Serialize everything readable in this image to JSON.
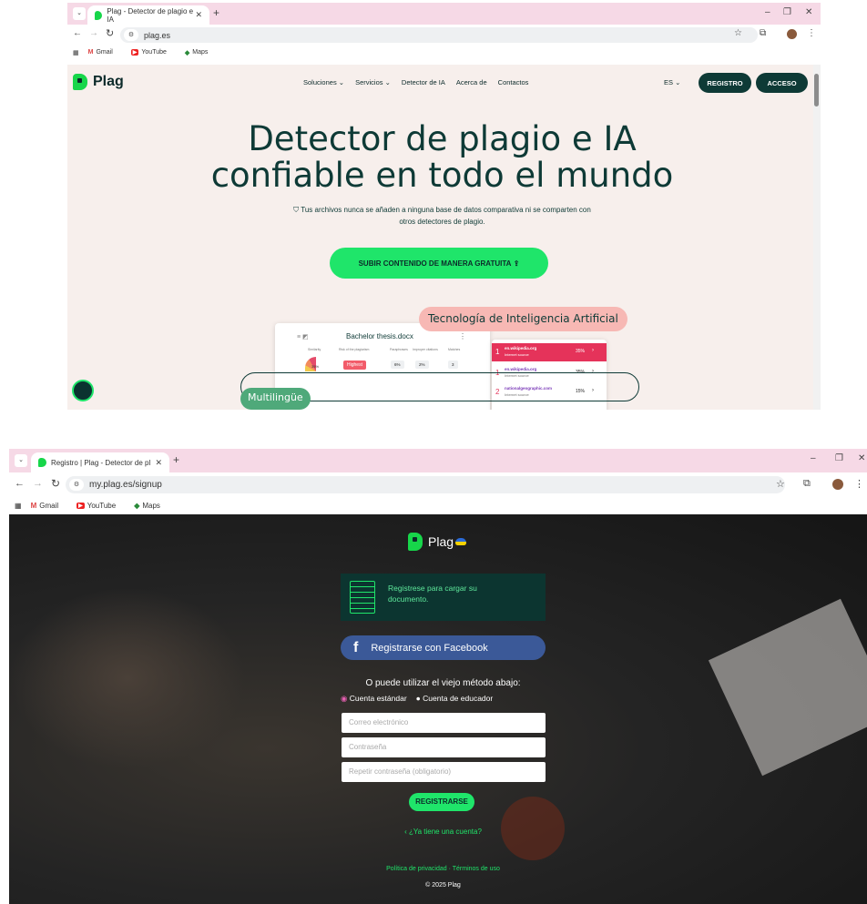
{
  "top_window": {
    "tab_title": "Plag - Detector de plagio e IA",
    "url": "plag.es",
    "bookmarks": [
      "Gmail",
      "YouTube",
      "Maps"
    ],
    "nav": {
      "brand": "Plag",
      "links": [
        "Soluciones",
        "Servicios",
        "Detector de IA",
        "Acerca de",
        "Contactos"
      ],
      "lang": "ES",
      "register": "REGISTRO",
      "login": "ACCESO"
    },
    "hero_line1": "Detector de plagio e IA",
    "hero_line2": "confiable en todo el mundo",
    "subtitle_line1": "Tus archivos nunca se añaden a ninguna base de datos comparativa ni se comparten con",
    "subtitle_line2": "otros detectores de plagio.",
    "cta": "SUBIR CONTENIDO DE MANERA GRATUITA",
    "badge_ai": "Tecnología de Inteligencia Artificial",
    "badge_multi": "Multilingüe",
    "preview": {
      "filename": "Bachelor thesis.docx",
      "metric_labels": [
        "Similarity",
        "Risk of the plagiarism",
        "Paraphrases",
        "Improper citations",
        "Matches"
      ],
      "risk": "Highest",
      "metric_values": [
        "6%",
        "2%",
        "3"
      ],
      "gauge": "35%",
      "sources": [
        {
          "num": "1",
          "site": "en.wikipedia.org",
          "type": "Internet source",
          "pct": "35%"
        },
        {
          "num": "1",
          "site": "en.wikipedia.org",
          "type": "Internet source",
          "pct": "35%"
        },
        {
          "num": "2",
          "site": "nationalgeographic.com",
          "type": "Internet source",
          "pct": "15%"
        }
      ]
    }
  },
  "bottom_window": {
    "tab_title": "Registro | Plag - Detector de pl",
    "url": "my.plag.es/signup",
    "bookmarks": [
      "Gmail",
      "YouTube",
      "Maps"
    ],
    "brand": "Plag",
    "info_text": "Registrese para cargar su documento.",
    "facebook_btn": "Registrarse con Facebook",
    "alt_method": "O puede utilizar el viejo método abajo:",
    "radio_standard": "Cuenta estándar",
    "radio_educator": "Cuenta de educador",
    "email_placeholder": "Correo electrónico",
    "password_placeholder": "Contraseña",
    "repeat_placeholder": "Repetir contraseña (obligatorio)",
    "submit": "REGISTRARSE",
    "have_account": "¿Ya tiene una cuenta?",
    "privacy": "Política de privacidad",
    "terms": "Términos de uso",
    "copyright": "© 2025 Plag"
  },
  "colors": {
    "brand_green": "#1fe56a",
    "brand_dark": "#0e3a36",
    "tab_strip": "#f6d9e6",
    "facebook": "#3b5998"
  }
}
